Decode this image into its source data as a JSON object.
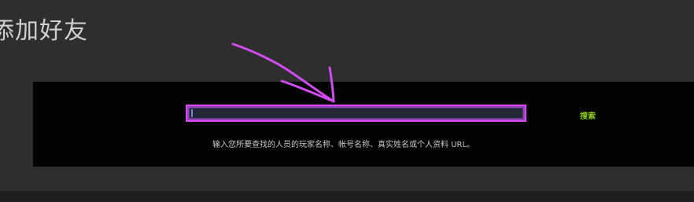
{
  "page": {
    "title": "添加好友"
  },
  "search": {
    "input_value": "",
    "button_label": "搜索",
    "hint": "输入您所要查找的人员的玩家名称、帐号名称、真实姓名或个人资料 URL。"
  },
  "colors": {
    "background": "#2e2e2e",
    "panel": "#030303",
    "highlight": "#d04cf0",
    "button_text": "#8fd11a"
  }
}
